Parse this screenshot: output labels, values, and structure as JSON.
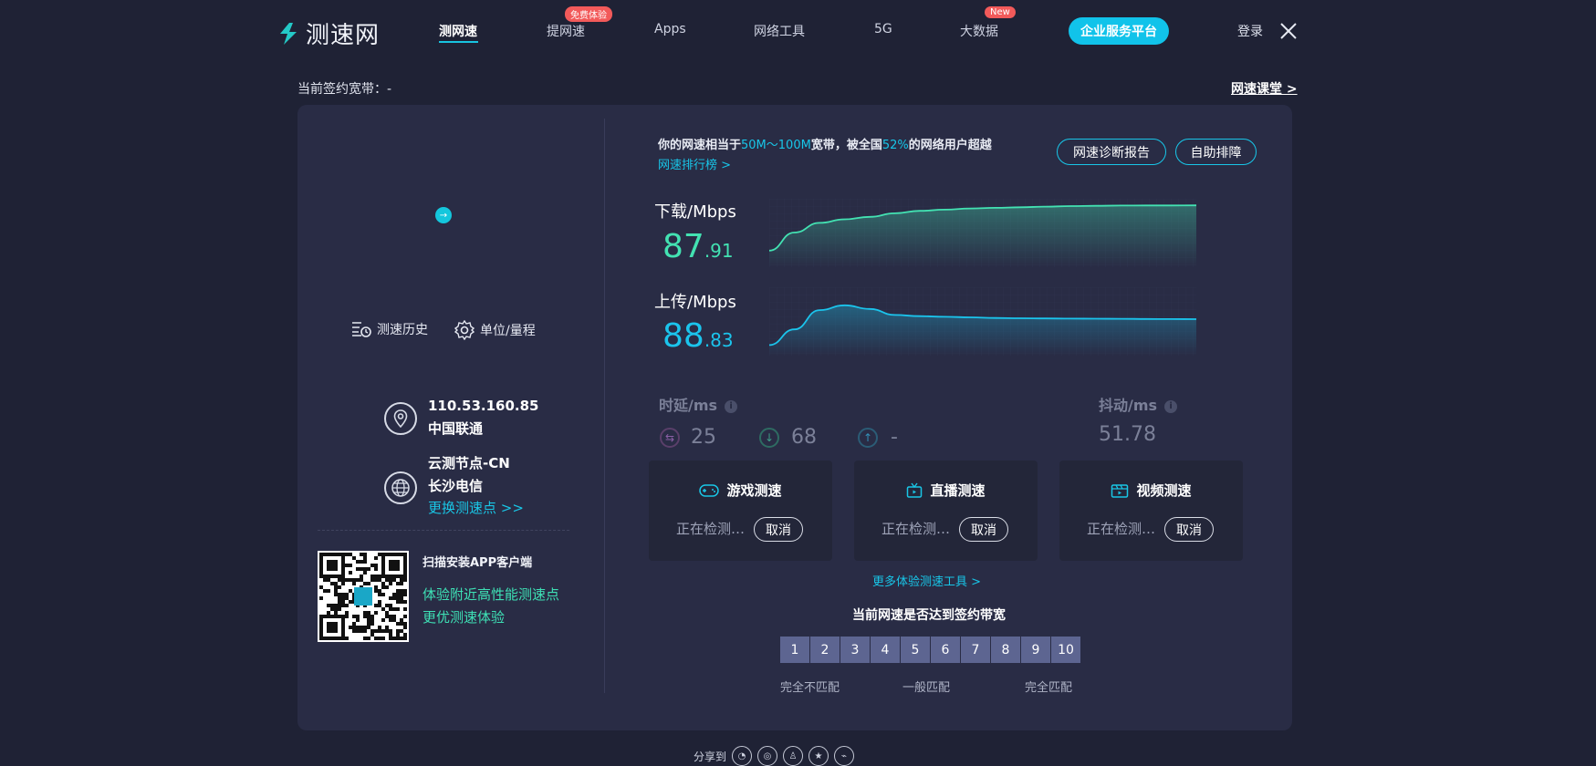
{
  "header": {
    "logo_text": "测速网",
    "nav": [
      {
        "label": "测网速",
        "active": true
      },
      {
        "label": "提网速",
        "badge": "免费体验"
      },
      {
        "label": "Apps"
      },
      {
        "label": "网络工具"
      },
      {
        "label": "5G"
      },
      {
        "label": "大数据",
        "badge": "New"
      }
    ],
    "enterprise_label": "企业服务平台",
    "login_label": "登录"
  },
  "top": {
    "contract_bandwidth": "当前签约宽带：-",
    "speed_course_link": "网速课堂 >"
  },
  "left": {
    "history_label": "测速历史",
    "unit_label": "单位/量程",
    "ip": "110.53.160.85",
    "isp": "中国联通",
    "node_name": "云测节点-CN",
    "node_isp": "长沙电信",
    "change_node": "更换测速点 >>",
    "scan_title": "扫描安装APP客户端",
    "scan_desc_1": "体验附近高性能测速点",
    "scan_desc_2": "更优测速体验"
  },
  "result": {
    "compare_prefix": "你的网速相当于",
    "compare_range": "50M～100M",
    "compare_mid": "宽带，被全国",
    "compare_percent": "52%",
    "compare_suffix": "的网络用户超越",
    "rank_link": "网速排行榜 >",
    "diagnose_btn": "网速诊断报告",
    "troubleshoot_btn": "自助排障"
  },
  "download": {
    "label": "下载/Mbps",
    "int": "87",
    "dec": ".91",
    "color": "#43e2b2",
    "curve": [
      10,
      25,
      33,
      36,
      38,
      41,
      43,
      44,
      45,
      45.5,
      46,
      46.5,
      47,
      47.2,
      47.4,
      47.5,
      47.5,
      47.6
    ]
  },
  "upload": {
    "label": "上传/Mbps",
    "int": "88",
    "dec": ".83",
    "color": "#1bc4ec",
    "curve": [
      5,
      18,
      34,
      38,
      35,
      30,
      29,
      28.5,
      28,
      27.5,
      27.3,
      27.1,
      27,
      26.9,
      26.8,
      26.7,
      26.6,
      26.5
    ]
  },
  "latency": {
    "label": "时延/ms",
    "info": "i",
    "ping": "25",
    "down": "68",
    "up": "-"
  },
  "jitter": {
    "label": "抖动/ms",
    "info": "i",
    "value": "51.78"
  },
  "cards": [
    {
      "title": "游戏测速",
      "status": "正在检测…",
      "cancel": "取消"
    },
    {
      "title": "直播测速",
      "status": "正在检测…",
      "cancel": "取消"
    },
    {
      "title": "视频测速",
      "status": "正在检测…",
      "cancel": "取消"
    }
  ],
  "more_tools": "更多体验测速工具 >",
  "match": {
    "title": "当前网速是否达到签约带宽",
    "scale": [
      "1",
      "2",
      "3",
      "4",
      "5",
      "6",
      "7",
      "8",
      "9",
      "10"
    ],
    "label_low": "完全不匹配",
    "label_mid": "一般匹配",
    "label_high": "完全匹配"
  },
  "share_label": "分享到"
}
